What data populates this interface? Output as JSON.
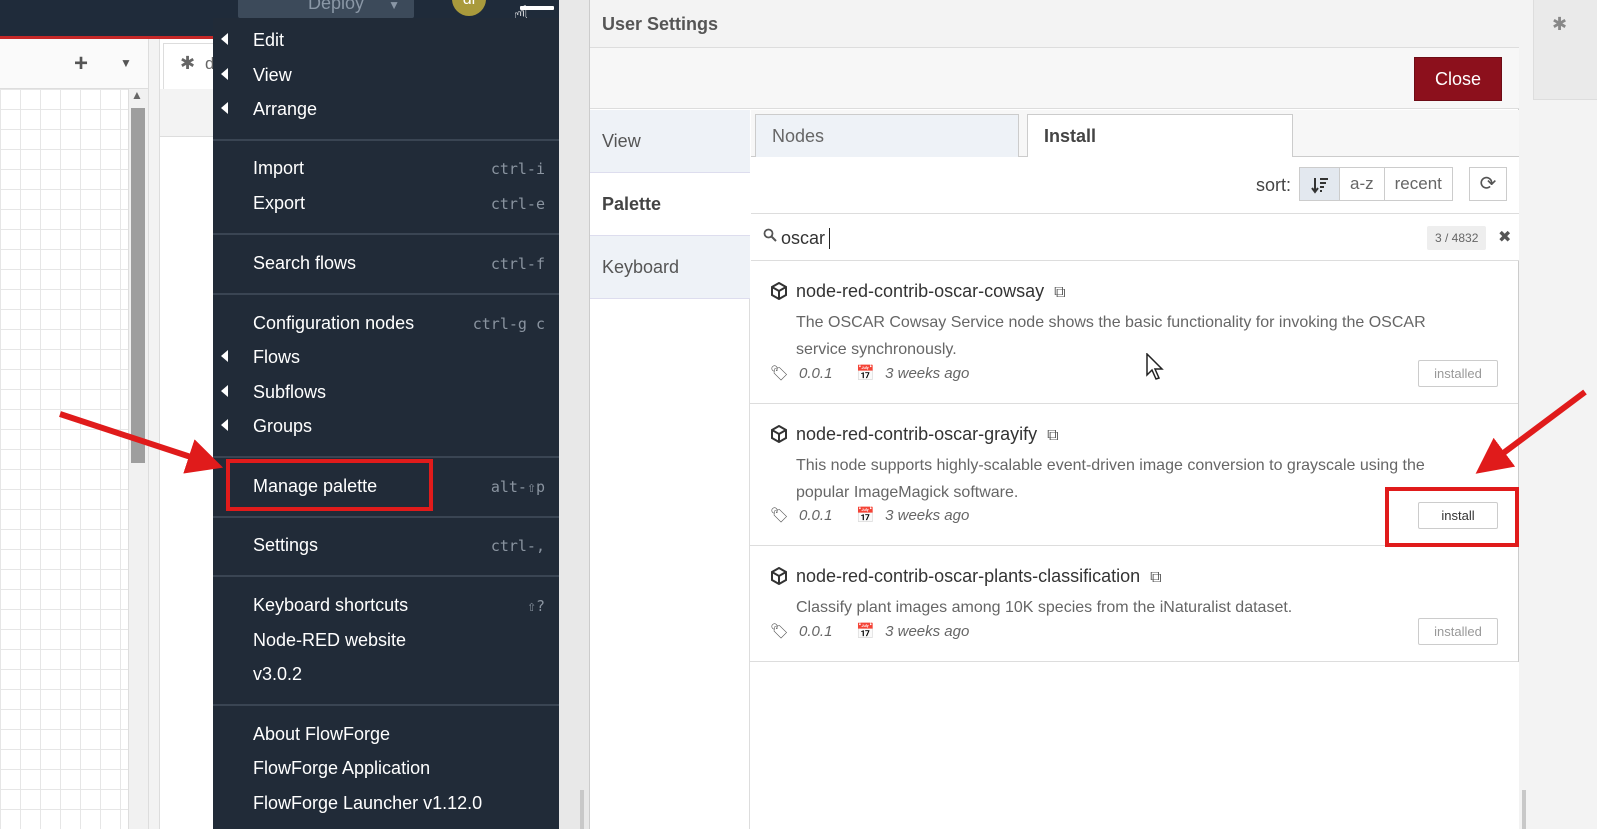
{
  "header": {
    "deploy_label": "Deploy",
    "user_initials": "dl"
  },
  "editor": {
    "debug_tab_label": "d"
  },
  "main_menu": {
    "items": [
      {
        "label": "Edit",
        "submenu": true,
        "shortcut": ""
      },
      {
        "label": "View",
        "submenu": true,
        "shortcut": ""
      },
      {
        "label": "Arrange",
        "submenu": true,
        "shortcut": ""
      },
      {
        "label": "Import",
        "submenu": false,
        "shortcut": "ctrl-i"
      },
      {
        "label": "Export",
        "submenu": false,
        "shortcut": "ctrl-e"
      },
      {
        "label": "Search flows",
        "submenu": false,
        "shortcut": "ctrl-f"
      },
      {
        "label": "Configuration nodes",
        "submenu": false,
        "shortcut": "ctrl-g c"
      },
      {
        "label": "Flows",
        "submenu": true,
        "shortcut": ""
      },
      {
        "label": "Subflows",
        "submenu": true,
        "shortcut": ""
      },
      {
        "label": "Groups",
        "submenu": true,
        "shortcut": ""
      },
      {
        "label": "Manage palette",
        "submenu": false,
        "shortcut": "alt-⇧p"
      },
      {
        "label": "Settings",
        "submenu": false,
        "shortcut": "ctrl-,"
      },
      {
        "label": "Keyboard shortcuts",
        "submenu": false,
        "shortcut": "⇧?"
      },
      {
        "label": "Node-RED website",
        "submenu": false,
        "shortcut": ""
      },
      {
        "label": "v3.0.2",
        "submenu": false,
        "shortcut": ""
      },
      {
        "label": "About FlowForge",
        "submenu": false,
        "shortcut": ""
      },
      {
        "label": "FlowForge Application",
        "submenu": false,
        "shortcut": ""
      },
      {
        "label": "FlowForge Launcher v1.12.0",
        "submenu": false,
        "shortcut": ""
      }
    ]
  },
  "settings": {
    "title": "User Settings",
    "close_label": "Close",
    "nav": [
      "View",
      "Palette",
      "Keyboard"
    ],
    "tabs": {
      "nodes": "Nodes",
      "install": "Install"
    },
    "sort": {
      "label": "sort:",
      "options": [
        "a-z",
        "recent"
      ]
    },
    "search": {
      "value": "oscar",
      "count": "3 / 4832"
    },
    "packages": [
      {
        "name": "node-red-contrib-oscar-cowsay",
        "description": "The OSCAR Cowsay Service node shows the basic functionality for invoking the OSCAR service synchronously.",
        "version": "0.0.1",
        "updated": "3 weeks ago",
        "action": "installed"
      },
      {
        "name": "node-red-contrib-oscar-grayify",
        "description": "This node supports highly-scalable event-driven image conversion to grayscale using the popular ImageMagick software.",
        "version": "0.0.1",
        "updated": "3 weeks ago",
        "action": "install"
      },
      {
        "name": "node-red-contrib-oscar-plants-classification",
        "description": "Classify plant images among 10K species from the iNaturalist dataset.",
        "version": "0.0.1",
        "updated": "3 weeks ago",
        "action": "installed"
      }
    ]
  },
  "colors": {
    "menu_bg": "#212b38",
    "close_button": "#8c101c",
    "annotation_red": "#e01b1b"
  }
}
